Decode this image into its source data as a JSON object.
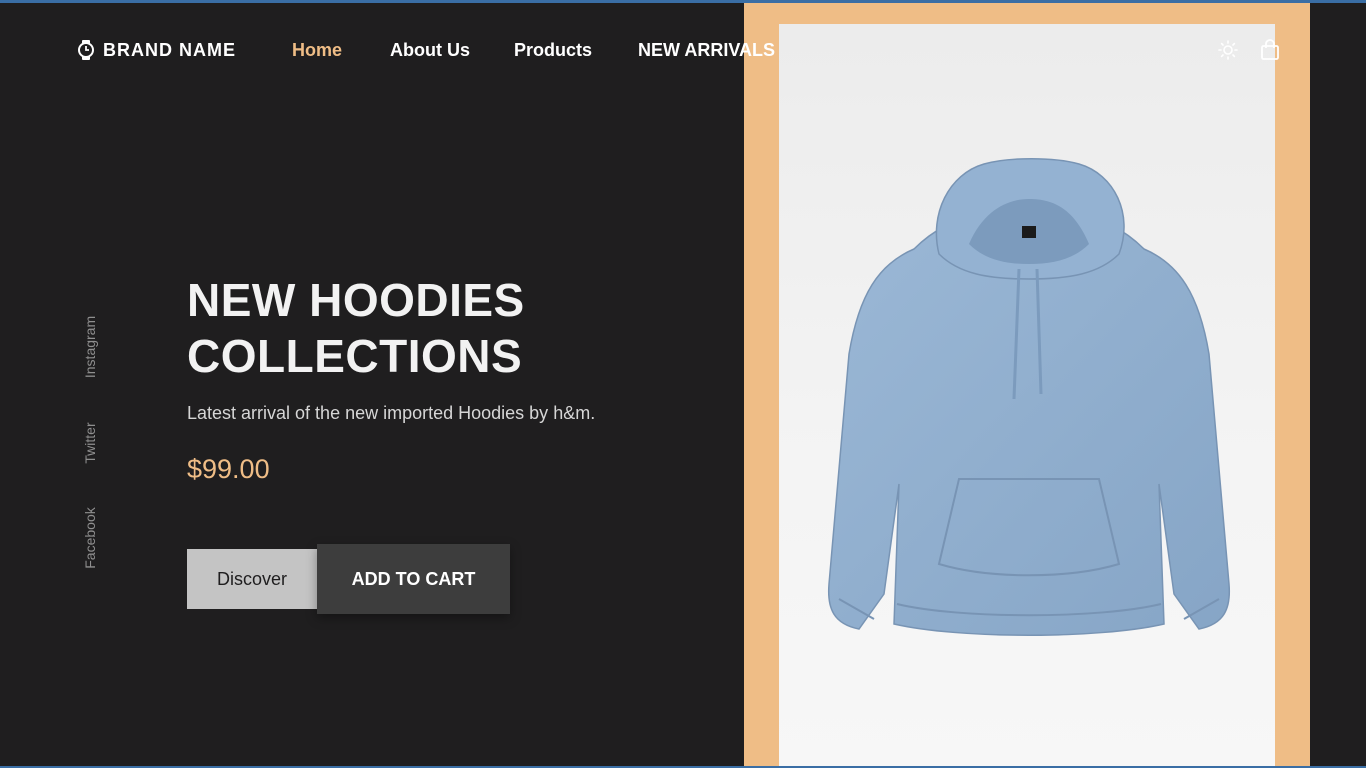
{
  "brand": {
    "name": "BRAND NAME",
    "logo_icon": "watch-icon"
  },
  "nav": {
    "links": [
      {
        "label": "Home",
        "active": true
      },
      {
        "label": "About Us",
        "active": false
      },
      {
        "label": "Products",
        "active": false
      },
      {
        "label": "NEW ARRIVALS",
        "active": false
      }
    ],
    "icons": [
      "sun-icon",
      "shopping-bag-icon"
    ]
  },
  "social": [
    "Instagram",
    "Twitter",
    "Facebook"
  ],
  "hero": {
    "title_line1": "NEW HOODIES",
    "title_line2": "COLLECTIONS",
    "subtitle": "Latest arrival of the new imported Hoodies by h&m.",
    "price": "$99.00",
    "discover_label": "Discover",
    "cart_label": "ADD TO CART"
  },
  "product_image": {
    "subject": "light blue hoodie"
  },
  "colors": {
    "background": "#1f1e1f",
    "accent": "#efbd86",
    "hoodie": "#8fadcc"
  }
}
